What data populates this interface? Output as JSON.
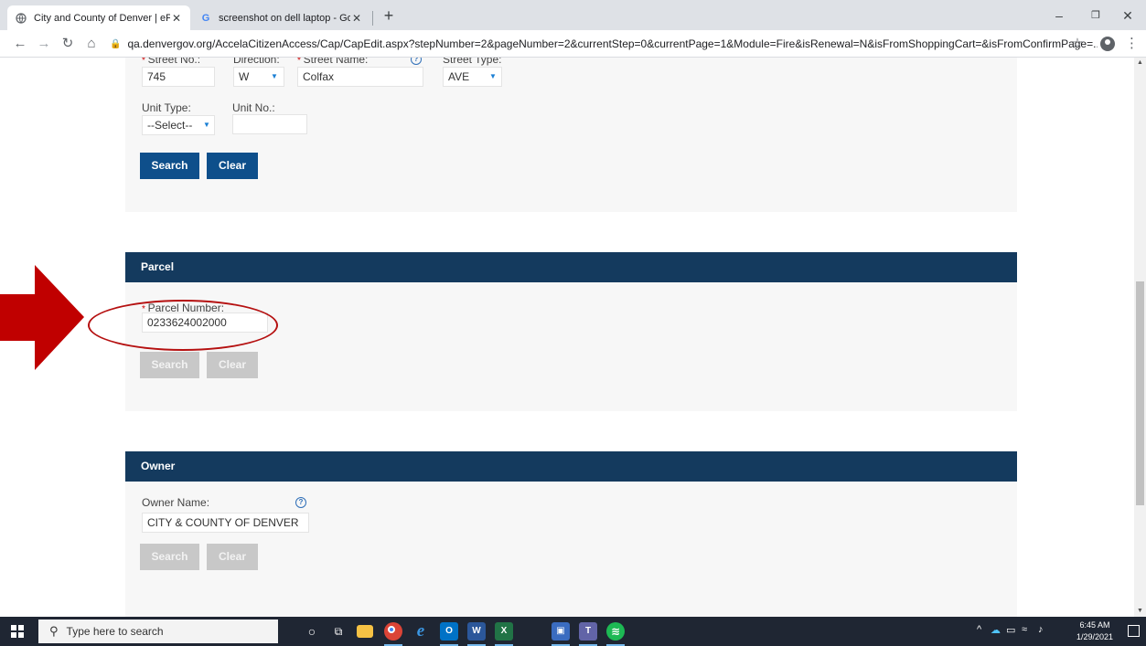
{
  "browser": {
    "tabs": [
      {
        "title": "City and County of Denver | ePerı",
        "favicon": "globe-icon",
        "active": true
      },
      {
        "title": "screenshot on dell laptop - Goog",
        "favicon": "google-g-icon",
        "active": false
      }
    ],
    "new_tab": "+",
    "url": "qa.denvergov.org/AccelaCitizenAccess/Cap/CapEdit.aspx?stepNumber=2&pageNumber=2&currentStep=0&currentPage=1&Module=Fire&isRenewal=N&isFromShoppingCart=&isFromConfirmPage=..."
  },
  "address_section": {
    "street_no_label": "Street No.:",
    "direction_label": "Direction:",
    "street_name_label": "Street Name:",
    "street_type_label": "Street Type:",
    "street_no": "745",
    "direction": "W",
    "street_name": "Colfax",
    "street_type": "AVE",
    "unit_type_label": "Unit Type:",
    "unit_no_label": "Unit No.:",
    "unit_type": "--Select--",
    "unit_no": "",
    "search_label": "Search",
    "clear_label": "Clear"
  },
  "parcel_section": {
    "header": "Parcel",
    "parcel_number_label": "Parcel Number:",
    "parcel_number": "0233624002000",
    "search_label": "Search",
    "clear_label": "Clear"
  },
  "owner_section": {
    "header": "Owner",
    "owner_name_label": "Owner Name:",
    "owner_name": "CITY & COUNTY OF DENVER",
    "search_label": "Search",
    "clear_label": "Clear"
  },
  "taskbar": {
    "search_placeholder": "Type here to search",
    "time": "6:45 AM",
    "date": "1/29/2021"
  },
  "colors": {
    "panel_header": "#143a5e",
    "primary_button": "#0e4f8b",
    "annotation": "#b51010"
  }
}
